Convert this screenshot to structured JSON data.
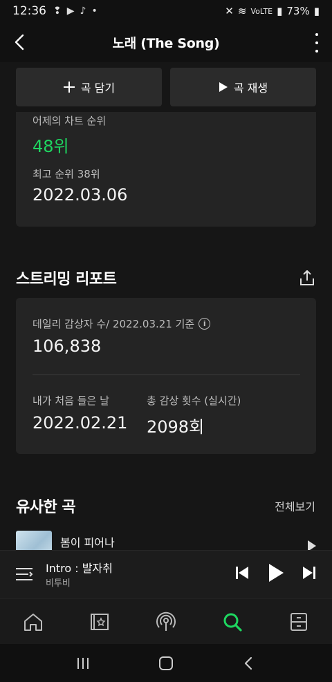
{
  "status_bar": {
    "time": "12:36",
    "left_icons": [
      "notification-icon",
      "youtube-icon",
      "tiktok-icon",
      "dot-icon"
    ],
    "battery": "73%",
    "right_icons": [
      "mute-icon",
      "wifi-icon",
      "volte-icon",
      "signal-icon",
      "battery-icon"
    ]
  },
  "header": {
    "title": "노래 (The Song)"
  },
  "actions": {
    "add_label": "곡 담기",
    "play_label": "곡 재생"
  },
  "chart_rank": {
    "yesterday_label": "어제의 차트 순위",
    "yesterday_value": "48위",
    "best_label": "최고 순위 38위",
    "best_date": "2022.03.06"
  },
  "streaming_report": {
    "title": "스트리밍 리포트",
    "daily_label": "데일리 감상자 수/ 2022.03.21 기준",
    "daily_value": "106,838",
    "first_listen_label": "내가 처음 들은 날",
    "first_listen_value": "2022.02.21",
    "total_plays_label": "총 감상 횟수 (실시간)",
    "total_plays_value": "2098회"
  },
  "similar": {
    "title": "유사한 곡",
    "see_all": "전체보기",
    "items": [
      {
        "title": "봄이 피어나"
      }
    ]
  },
  "now_playing": {
    "title": "Intro : 발자취",
    "artist": "비투비"
  },
  "colors": {
    "accent": "#1ED760",
    "background": "#161616",
    "card": "#242424"
  }
}
